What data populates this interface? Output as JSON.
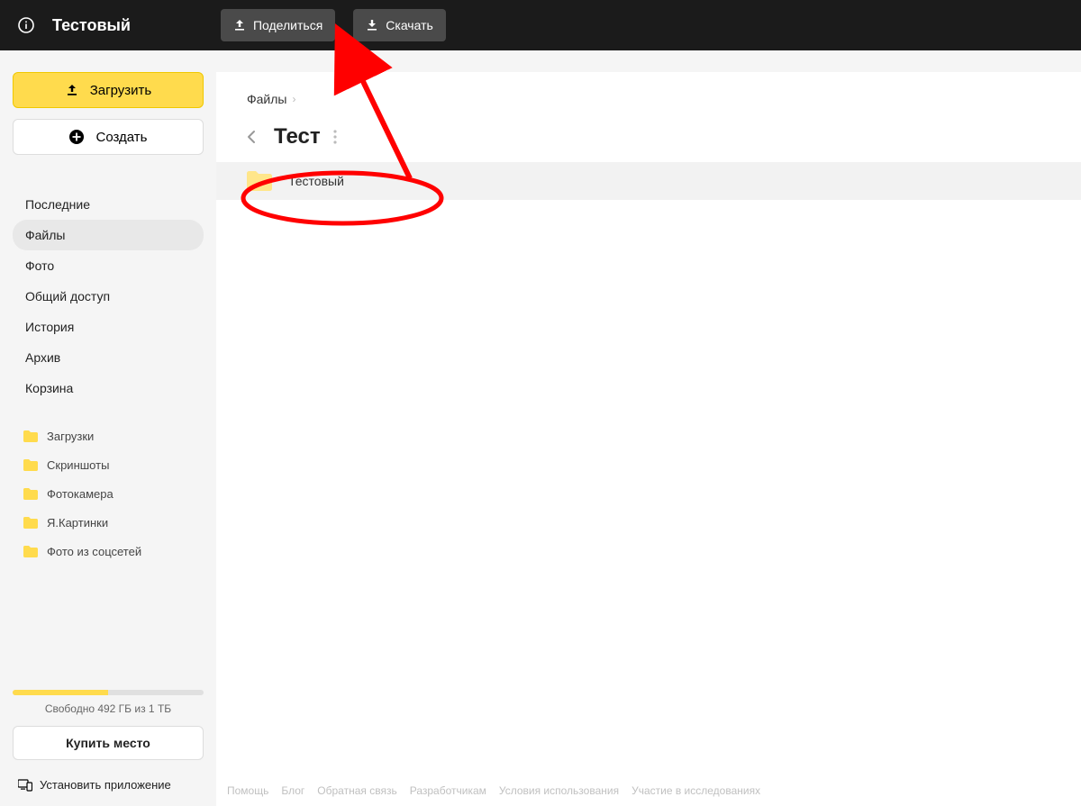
{
  "topbar": {
    "title": "Тестовый",
    "share_label": "Поделиться",
    "download_label": "Скачать"
  },
  "sidebar": {
    "upload_label": "Загрузить",
    "create_label": "Создать",
    "nav": [
      {
        "label": "Последние",
        "active": false
      },
      {
        "label": "Файлы",
        "active": true
      },
      {
        "label": "Фото",
        "active": false
      },
      {
        "label": "Общий доступ",
        "active": false
      },
      {
        "label": "История",
        "active": false
      },
      {
        "label": "Архив",
        "active": false
      },
      {
        "label": "Корзина",
        "active": false
      }
    ],
    "folders": [
      {
        "label": "Загрузки"
      },
      {
        "label": "Скриншоты"
      },
      {
        "label": "Фотокамера"
      },
      {
        "label": "Я.Картинки"
      },
      {
        "label": "Фото из соцсетей"
      }
    ],
    "storage_text": "Свободно 492 ГБ из 1 ТБ",
    "storage_percent": 50,
    "buy_label": "Купить место",
    "install_label": "Установить приложение"
  },
  "content": {
    "breadcrumb_root": "Файлы",
    "heading": "Тест",
    "items": [
      {
        "name": "Тестовый"
      }
    ]
  },
  "footer": {
    "links": [
      "Помощь",
      "Блог",
      "Обратная связь",
      "Разработчикам",
      "Условия использования",
      "Участие в исследованиях"
    ]
  },
  "colors": {
    "accent": "#ffdb4d",
    "topbar_bg": "#1b1b1b",
    "annotation": "#ff0000"
  }
}
